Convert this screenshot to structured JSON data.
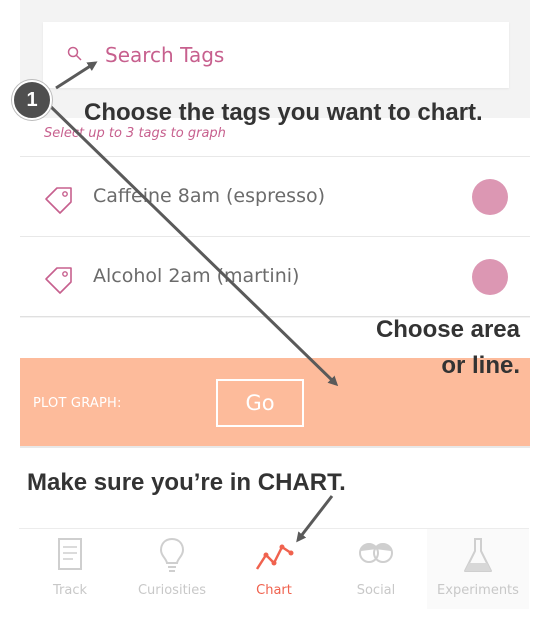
{
  "search": {
    "placeholder": "Search Tags"
  },
  "tags": {
    "hint": "Select up to 3 tags to graph",
    "items": [
      {
        "label": "Caffeine 8am (espresso)"
      },
      {
        "label": "Alcohol 2am (martini)"
      }
    ],
    "dot_color": "#dc97b3"
  },
  "plot": {
    "label": "PLOT GRAPH:",
    "go": "Go",
    "color": "#fdbb9b"
  },
  "nav": {
    "items": [
      {
        "label": "Track",
        "icon": "notebook-icon"
      },
      {
        "label": "Curiosities",
        "icon": "lightbulb-icon"
      },
      {
        "label": "Chart",
        "icon": "chart-line-icon",
        "active": true
      },
      {
        "label": "Social",
        "icon": "people-icon"
      },
      {
        "label": "Experiments",
        "icon": "flask-icon"
      }
    ],
    "active_color": "#f0624e"
  },
  "annotations": {
    "step_number": "1",
    "choose_tags": "Choose the tags you want to chart.",
    "choose_area_1": "Choose area",
    "choose_area_2": "or line.",
    "make_sure": "Make sure you’re in CHART."
  }
}
